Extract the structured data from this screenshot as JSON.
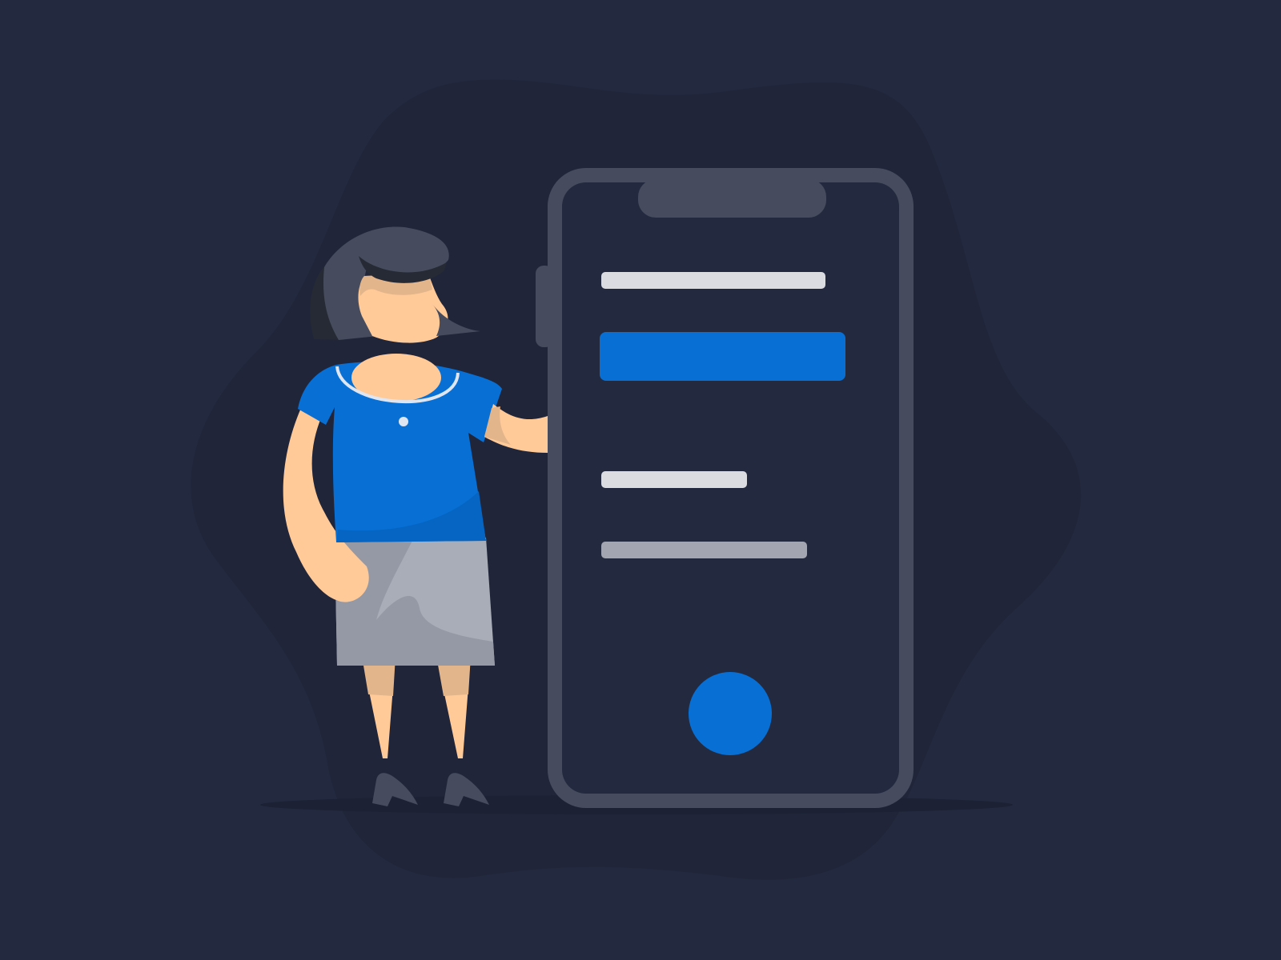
{
  "colors": {
    "background": "#232a3f",
    "blob": "#20253a",
    "phone_frame": "#464c5e",
    "phone_screen": "#232a3f",
    "accent_blue": "#0870d5",
    "skin": "#ffca98",
    "skin_shade": "#e3b58b",
    "hair": "#464c5e",
    "hair_dark": "#262a35",
    "skirt": "#a8adb8",
    "skirt_shade": "#9599a5",
    "text_line_light": "#dadce2",
    "text_line_gray": "#a3a6b0"
  },
  "illustration": {
    "subject": "person-standing-next-to-phone",
    "phone_screen_elements": [
      "text-line",
      "primary-button",
      "text-line",
      "text-line",
      "round-action-button"
    ]
  }
}
